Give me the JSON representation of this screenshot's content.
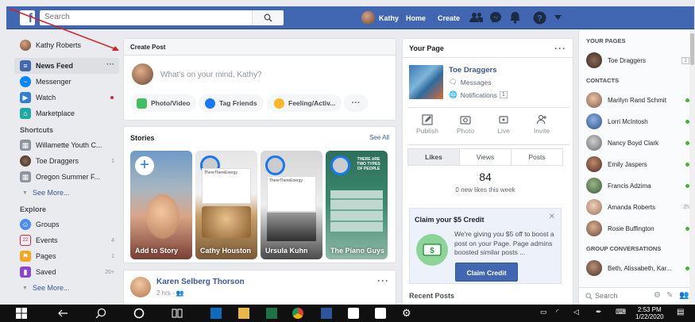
{
  "topbar": {
    "search_placeholder": "Search",
    "user_name": "Kathy",
    "home": "Home",
    "create": "Create"
  },
  "leftnav": {
    "profile": "Kathy Roberts",
    "news_feed": "News Feed",
    "messenger": "Messenger",
    "watch": "Watch",
    "marketplace": "Marketplace",
    "shortcuts_heading": "Shortcuts",
    "shortcuts": [
      {
        "label": "Willamette Youth C...",
        "count": ""
      },
      {
        "label": "Toe Draggers",
        "count": "1"
      },
      {
        "label": "Oregon Summer F...",
        "count": ""
      }
    ],
    "see_more_1": "See More...",
    "explore_heading": "Explore",
    "explore": [
      {
        "label": "Groups",
        "count": ""
      },
      {
        "label": "Events",
        "count": "4"
      },
      {
        "label": "Pages",
        "count": "1"
      },
      {
        "label": "Saved",
        "count": "20+"
      }
    ],
    "see_more_2": "See More..."
  },
  "create_post": {
    "title": "Create Post",
    "placeholder": "What's on your mind, Kathy?",
    "photo_video": "Photo/Video",
    "tag_friends": "Tag Friends",
    "feeling": "Feeling/Activ..."
  },
  "stories": {
    "title": "Stories",
    "see_all": "See All",
    "items": [
      "Add to Story",
      "Cathy Houston",
      "Ursula Kuhn",
      "The Piano Guys"
    ],
    "card_texts": [
      "ThereThereEnergy",
      "ThereThereEnergy",
      "THERE ARE TWO TYPES OF PEOPLE"
    ]
  },
  "post": {
    "author": "Karen Selberg Thorson",
    "meta": "2 hrs ·"
  },
  "your_page": {
    "title": "Your Page",
    "page_name": "Toe Draggers",
    "messages": "Messages",
    "notifications": "Notifications",
    "notif_count": "1",
    "actions": [
      "Publish",
      "Photo",
      "Live",
      "Invite"
    ],
    "tabs": [
      "Likes",
      "Views",
      "Posts"
    ],
    "likes_count": "84",
    "likes_caption": "0 new likes this week",
    "credit_title": "Claim your $5 Credit",
    "credit_text": "We're giving you $5 off to boost a post on your Page. Page admins boosted similar posts ...",
    "claim_button": "Claim Credit",
    "recent_posts": "Recent Posts"
  },
  "chat": {
    "your_pages_heading": "YOUR PAGES",
    "page_item": "Toe Draggers",
    "page_count": "1",
    "contacts_heading": "CONTACTS",
    "contacts": [
      {
        "name": "Marilyn Rand Schmit",
        "status": "online",
        "time": ""
      },
      {
        "name": "Lorri McIntosh",
        "status": "online",
        "time": ""
      },
      {
        "name": "Nancy Boyd Clark",
        "status": "online",
        "time": ""
      },
      {
        "name": "Emily Jaspers",
        "status": "online",
        "time": ""
      },
      {
        "name": "Francis Adzima",
        "status": "online",
        "time": ""
      },
      {
        "name": "Amanda Roberts",
        "status": "away",
        "time": "2h"
      },
      {
        "name": "Rosie Buffington",
        "status": "online",
        "time": ""
      }
    ],
    "group_heading": "GROUP CONVERSATIONS",
    "group_item": "Beth, Alissabeth, Kar...",
    "search_placeholder": "Search"
  },
  "taskbar": {
    "time": "2:53 PM",
    "date": "1/22/2020"
  },
  "colors": {
    "brand": "#4267b2",
    "link": "#385898",
    "online": "#42b72a"
  }
}
